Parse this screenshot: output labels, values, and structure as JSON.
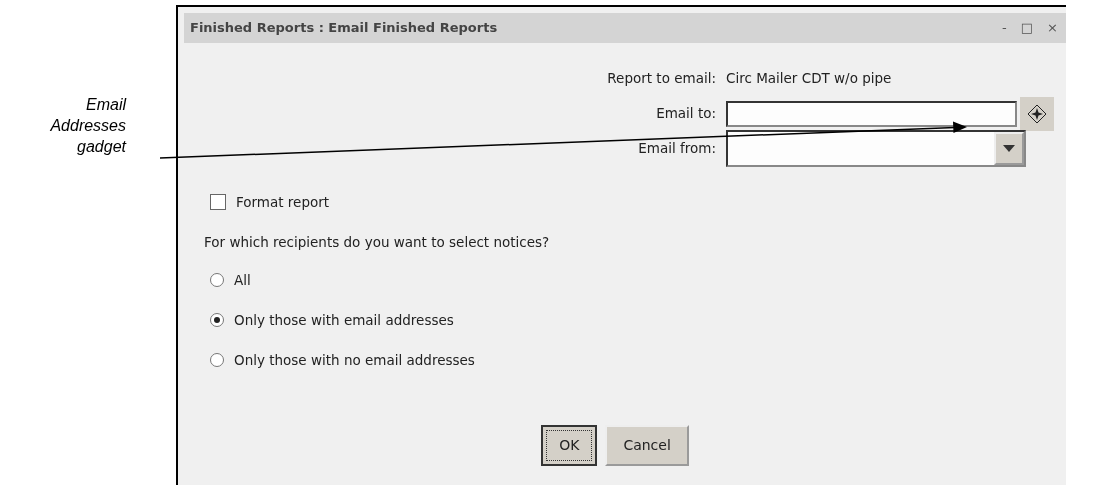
{
  "callout": {
    "text": "Email Addresses gadget"
  },
  "window": {
    "title": "Finished Reports : Email Finished Reports",
    "controls": [
      "-",
      "□",
      "×"
    ]
  },
  "report_to_email": {
    "label": "Report to email:",
    "value": "Circ Mailer CDT w/o pipe"
  },
  "email_to": {
    "label": "Email to:"
  },
  "email_from": {
    "label": "Email from:"
  },
  "format_report": {
    "label": "Format report",
    "checked": false
  },
  "question": "For which recipients do you want to select notices?",
  "options": [
    {
      "label": "All",
      "selected": false
    },
    {
      "label": "Only those with email addresses",
      "selected": true
    },
    {
      "label": "Only those with no email addresses",
      "selected": false
    }
  ],
  "buttons": [
    {
      "label": "OK",
      "focused": true
    },
    {
      "label": "Cancel",
      "focused": false
    }
  ]
}
